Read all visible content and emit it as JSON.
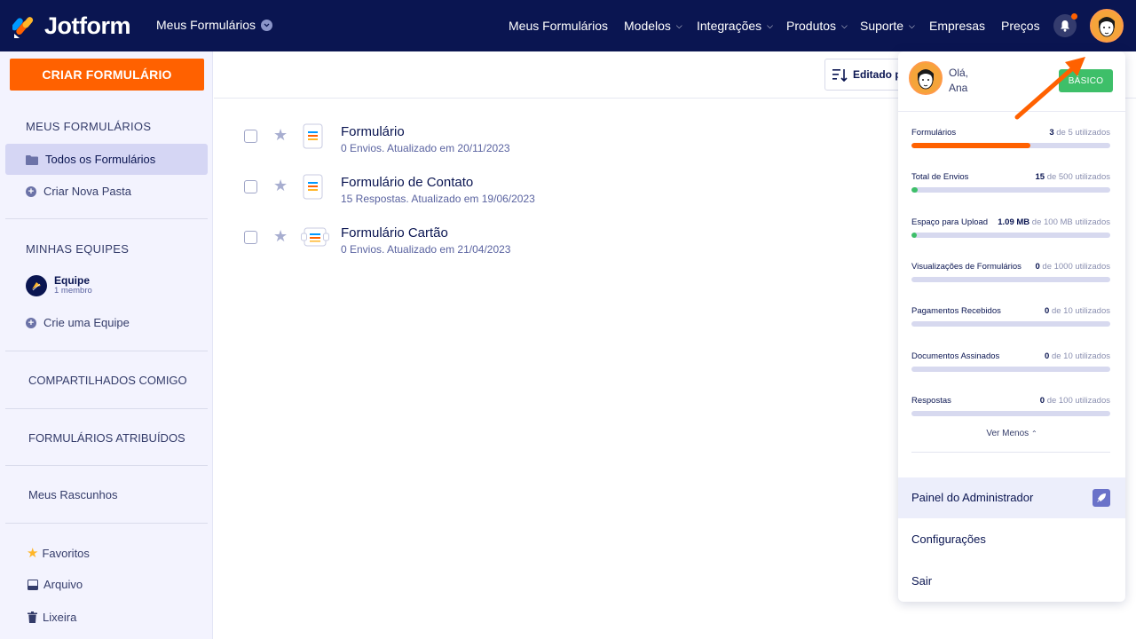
{
  "header": {
    "brand": "Jotform",
    "workspace": "Meus Formulários",
    "nav": [
      {
        "label": "Meus Formulários",
        "dropdown": false
      },
      {
        "label": "Modelos",
        "dropdown": true
      },
      {
        "label": "Integrações",
        "dropdown": true
      },
      {
        "label": "Produtos",
        "dropdown": true
      },
      {
        "label": "Suporte",
        "dropdown": true
      },
      {
        "label": "Empresas",
        "dropdown": false
      },
      {
        "label": "Preços",
        "dropdown": false
      }
    ],
    "notification_icon": "bell-icon",
    "avatar_icon": "user-avatar"
  },
  "sidebar": {
    "create_button": "CRIAR FORMULÁRIO",
    "my_forms_heading": "MEUS FORMULÁRIOS",
    "all_forms": "Todos os Formulários",
    "new_folder": "Criar Nova Pasta",
    "teams_heading": "MINHAS EQUIPES",
    "team_name": "Equipe",
    "team_members": "1 membro",
    "create_team": "Crie uma Equipe",
    "shared": "COMPARTILHADOS COMIGO",
    "assigned": "FORMULÁRIOS ATRIBUÍDOS",
    "drafts": "Meus Rascunhos",
    "favorites": "Favoritos",
    "archive": "Arquivo",
    "trash": "Lixeira"
  },
  "main": {
    "sort_label": "Editado po",
    "forms": [
      {
        "title": "Formulário",
        "meta": "0 Envios. Atualizado em 20/11/2023",
        "icon": "form-icon"
      },
      {
        "title": "Formulário de Contato",
        "meta": "15 Respostas. Atualizado em 19/06/2023",
        "icon": "form-icon"
      },
      {
        "title": "Formulário Cartão",
        "meta": "0 Envios. Atualizado em 21/04/2023",
        "icon": "card-form-icon"
      }
    ]
  },
  "account_menu": {
    "greeting": "Olá,",
    "name": "Ana",
    "plan": "BÁSICO",
    "usage": [
      {
        "label": "Formulários",
        "used": "3",
        "limit_text": "de 5 utilizados",
        "fraction": 0.6,
        "color": "#ff6100"
      },
      {
        "label": "Total de Envios",
        "used": "15",
        "limit_text": "de 500 utilizados",
        "fraction": 0.03,
        "color": "#3ebf69"
      },
      {
        "label": "Espaço para Upload",
        "used": "1.09 MB",
        "limit_text": "de 100 MB utilizados",
        "fraction": 0.011,
        "color": "#3ebf69"
      },
      {
        "label": "Visualizações de Formulários",
        "used": "0",
        "limit_text": "de 1000 utilizados",
        "fraction": 0,
        "color": "#3ebf69"
      },
      {
        "label": "Pagamentos Recebidos",
        "used": "0",
        "limit_text": "de 10 utilizados",
        "fraction": 0,
        "color": "#3ebf69"
      },
      {
        "label": "Documentos Assinados",
        "used": "0",
        "limit_text": "de 10 utilizados",
        "fraction": 0,
        "color": "#3ebf69"
      },
      {
        "label": "Respostas",
        "used": "0",
        "limit_text": "de 100 utilizados",
        "fraction": 0,
        "color": "#3ebf69"
      }
    ],
    "see_less": "Ver Menos",
    "admin_panel": "Painel do Administrador",
    "settings": "Configurações",
    "logout": "Sair"
  },
  "colors": {
    "navy": "#0a1551",
    "orange": "#ff6100",
    "green": "#3ebf69"
  }
}
